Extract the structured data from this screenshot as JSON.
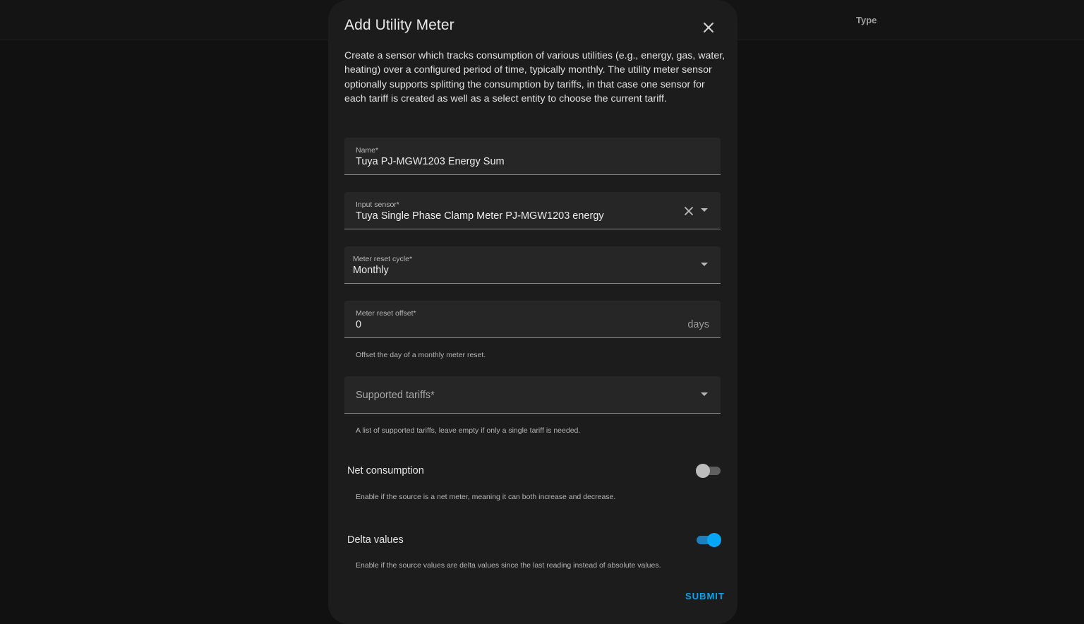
{
  "background": {
    "column_header": "Type"
  },
  "dialog": {
    "title": "Add Utility Meter",
    "description": "Create a sensor which tracks consumption of various utilities (e.g., energy, gas, water, heating) over a configured period of time, typically monthly. The utility meter sensor optionally supports splitting the consumption by tariffs, in that case one sensor for each tariff is created as well as a select entity to choose the current tariff.",
    "fields": {
      "name": {
        "label": "Name*",
        "value": "Tuya PJ-MGW1203 Energy Sum"
      },
      "input_sensor": {
        "label": "Input sensor*",
        "value": "Tuya Single Phase Clamp Meter PJ-MGW1203 energy"
      },
      "reset_cycle": {
        "label": "Meter reset cycle*",
        "value": "Monthly"
      },
      "reset_offset": {
        "label": "Meter reset offset*",
        "value": "0",
        "suffix": "days",
        "helper": "Offset the day of a monthly meter reset."
      },
      "tariffs": {
        "label": "Supported tariffs*",
        "helper": "A list of supported tariffs, leave empty if only a single tariff is needed."
      }
    },
    "toggles": {
      "net_consumption": {
        "label": "Net consumption",
        "checked": false,
        "helper": "Enable if the source is a net meter, meaning it can both increase and decrease."
      },
      "delta_values": {
        "label": "Delta values",
        "checked": true,
        "helper": "Enable if the source values are delta values since the last reading instead of absolute values."
      }
    },
    "submit_label": "SUBMIT"
  },
  "colors": {
    "accent": "#07a6f4",
    "surface": "#1c1c1c",
    "field_bg": "#262626",
    "backdrop": "#111111"
  },
  "icons": {
    "close": "close-icon",
    "clear": "clear-icon",
    "dropdown": "chevron-down-icon"
  }
}
